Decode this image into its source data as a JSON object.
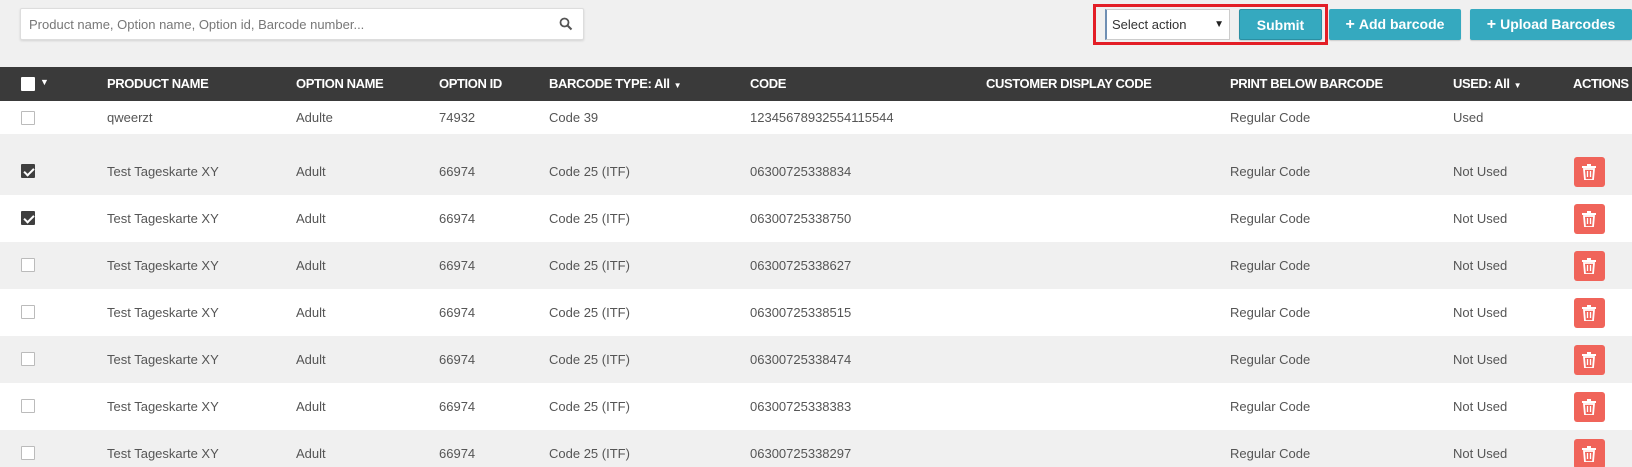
{
  "search": {
    "placeholder": "Product name, Option name, Option id, Barcode number..."
  },
  "toolbar": {
    "select_value": "Select action",
    "submit_label": "Submit",
    "add_barcode_label": "Add barcode",
    "upload_barcodes_label": "Upload Barcodes"
  },
  "table": {
    "headers": {
      "product_name": "PRODUCT NAME",
      "option_name": "OPTION NAME",
      "option_id": "OPTION ID",
      "barcode_type": "BARCODE TYPE: All",
      "code": "CODE",
      "customer_display_code": "CUSTOMER DISPLAY CODE",
      "print_below_barcode": "PRINT BELOW BARCODE",
      "used": "USED: All",
      "actions": "ACTIONS"
    },
    "rows": [
      {
        "checked": false,
        "product_name": "qweerzt",
        "option_name": "Adulte",
        "option_id": "74932",
        "barcode_type": "Code 39",
        "code": "12345678932554115544",
        "customer_display_code": "",
        "print_below_barcode": "Regular Code",
        "used": "Used",
        "has_delete": false
      },
      {
        "checked": true,
        "product_name": "Test Tageskarte XY",
        "option_name": "Adult",
        "option_id": "66974",
        "barcode_type": "Code 25 (ITF)",
        "code": "06300725338834",
        "customer_display_code": "",
        "print_below_barcode": "Regular Code",
        "used": "Not Used",
        "has_delete": true
      },
      {
        "checked": true,
        "product_name": "Test Tageskarte XY",
        "option_name": "Adult",
        "option_id": "66974",
        "barcode_type": "Code 25 (ITF)",
        "code": "06300725338750",
        "customer_display_code": "",
        "print_below_barcode": "Regular Code",
        "used": "Not Used",
        "has_delete": true
      },
      {
        "checked": false,
        "product_name": "Test Tageskarte XY",
        "option_name": "Adult",
        "option_id": "66974",
        "barcode_type": "Code 25 (ITF)",
        "code": "06300725338627",
        "customer_display_code": "",
        "print_below_barcode": "Regular Code",
        "used": "Not Used",
        "has_delete": true
      },
      {
        "checked": false,
        "product_name": "Test Tageskarte XY",
        "option_name": "Adult",
        "option_id": "66974",
        "barcode_type": "Code 25 (ITF)",
        "code": "06300725338515",
        "customer_display_code": "",
        "print_below_barcode": "Regular Code",
        "used": "Not Used",
        "has_delete": true
      },
      {
        "checked": false,
        "product_name": "Test Tageskarte XY",
        "option_name": "Adult",
        "option_id": "66974",
        "barcode_type": "Code 25 (ITF)",
        "code": "06300725338474",
        "customer_display_code": "",
        "print_below_barcode": "Regular Code",
        "used": "Not Used",
        "has_delete": true
      },
      {
        "checked": false,
        "product_name": "Test Tageskarte XY",
        "option_name": "Adult",
        "option_id": "66974",
        "barcode_type": "Code 25 (ITF)",
        "code": "06300725338383",
        "customer_display_code": "",
        "print_below_barcode": "Regular Code",
        "used": "Not Used",
        "has_delete": true
      },
      {
        "checked": false,
        "product_name": "Test Tageskarte XY",
        "option_name": "Adult",
        "option_id": "66974",
        "barcode_type": "Code 25 (ITF)",
        "code": "06300725338297",
        "customer_display_code": "",
        "print_below_barcode": "Regular Code",
        "used": "Not Used",
        "has_delete": true
      }
    ]
  },
  "colors": {
    "accent": "#35a9bf",
    "header_bg": "#3a3a3a",
    "delete": "#f0645a",
    "highlight_border": "#e31e26"
  }
}
